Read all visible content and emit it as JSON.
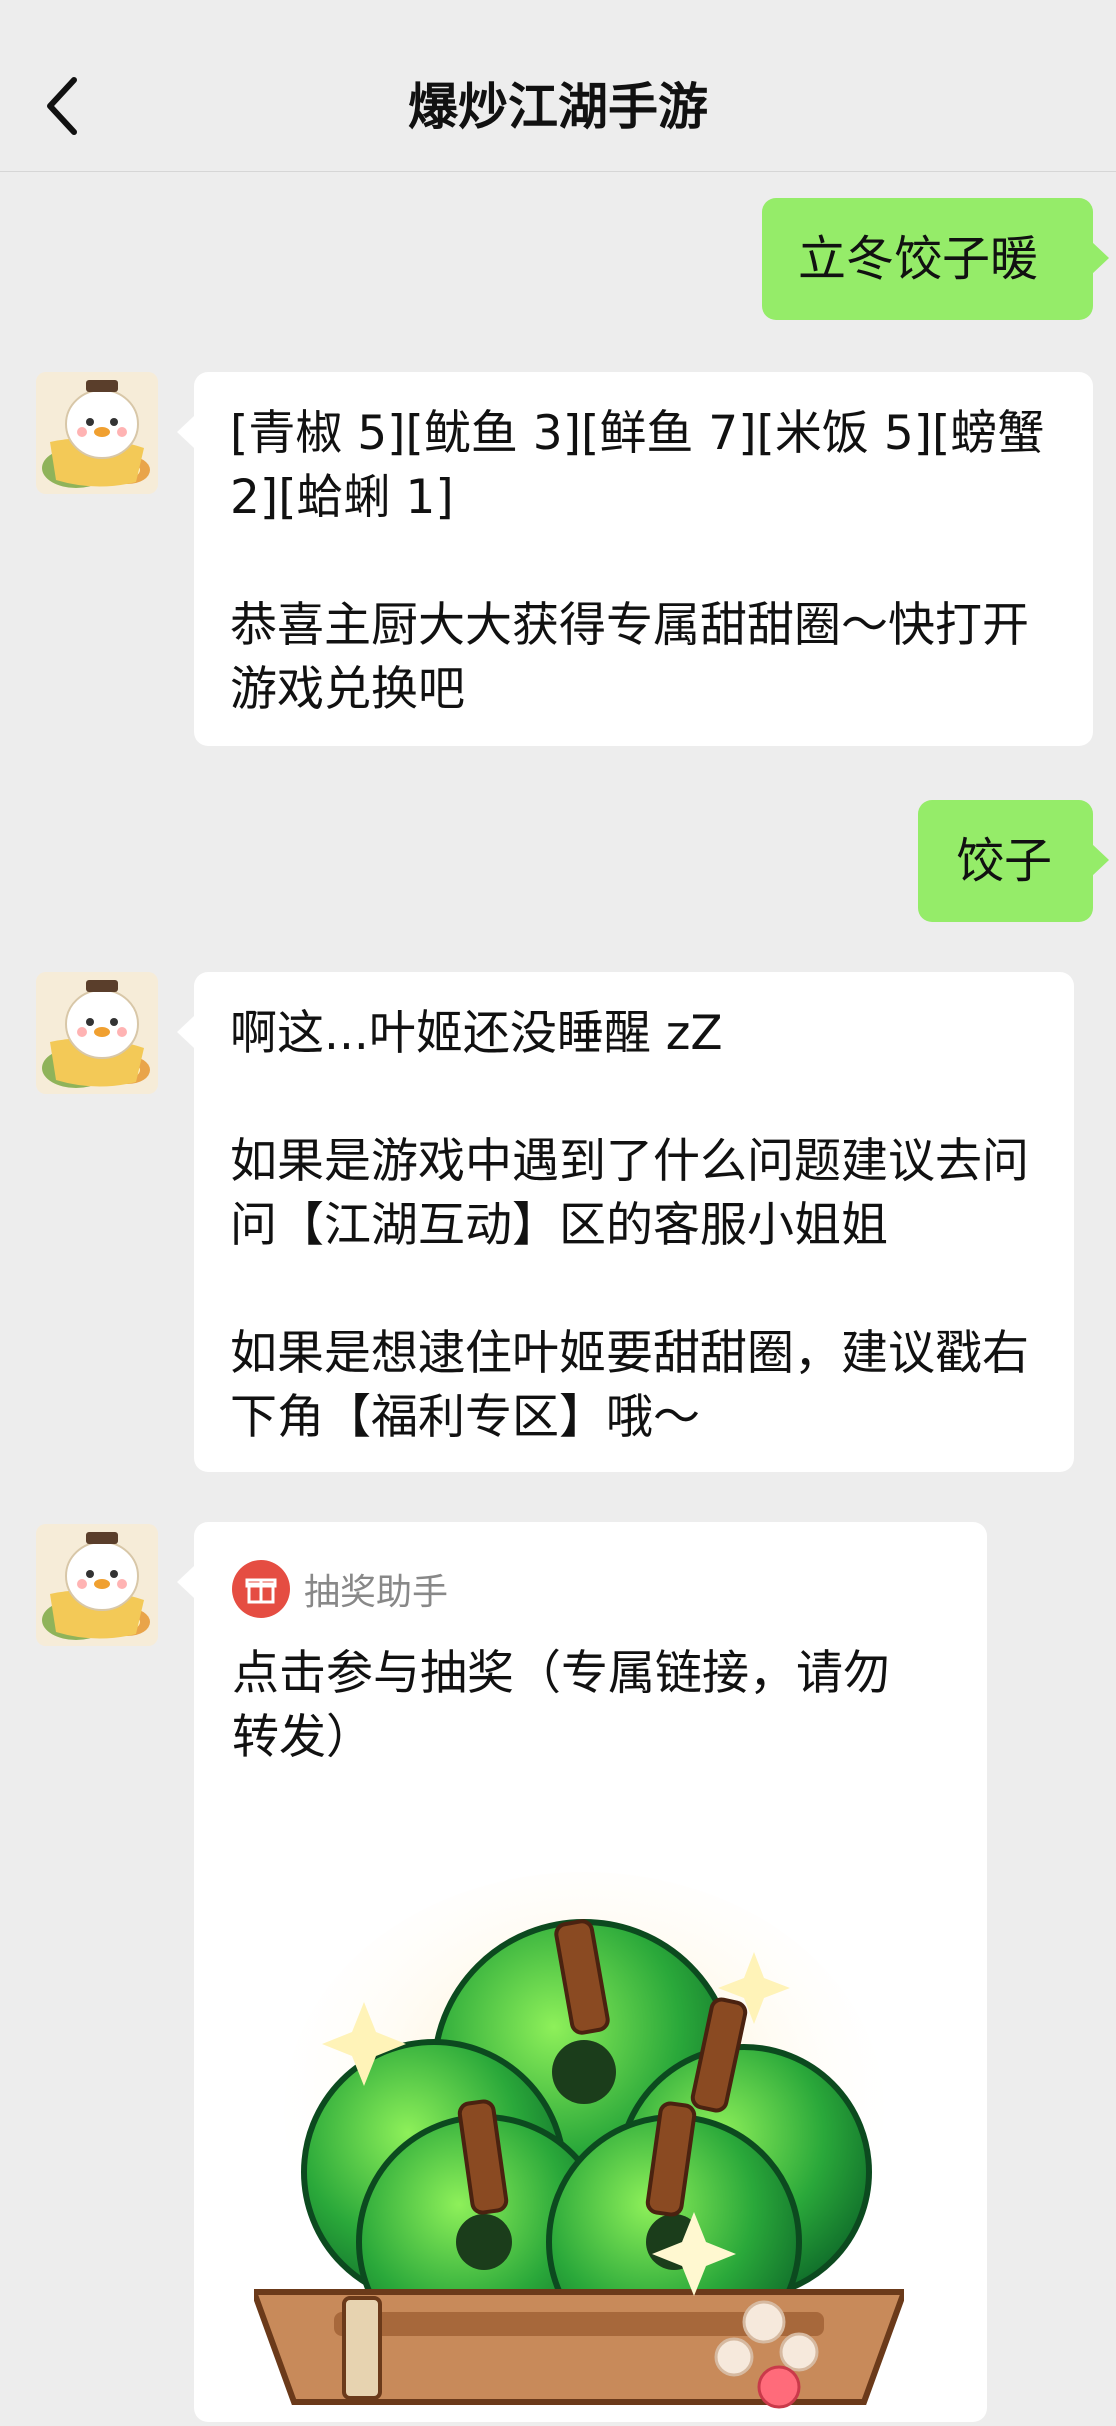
{
  "header": {
    "title": "爆炒江湖手游"
  },
  "messages": {
    "m1": {
      "text": "立冬饺子暖"
    },
    "m2": {
      "line1": "[青椒 5][鱿鱼 3][鲜鱼 7][米饭 5][螃蟹 2][蛤蜊 1]",
      "line2": "恭喜主厨大大获得专属甜甜圈～快打开游戏兑换吧"
    },
    "m3": {
      "text": "饺子"
    },
    "m4": {
      "line1": "啊这...叶姬还没睡醒 zZ",
      "line2": "如果是游戏中遇到了什么问题建议去问问【江湖互动】区的客服小姐姐",
      "line3": "如果是想逮住叶姬要甜甜圈，建议戳右下角【福利专区】哦～"
    },
    "m5": {
      "source": "抽奖助手",
      "title": "点击参与抽奖（专属链接，请勿转发）"
    }
  },
  "colors": {
    "outgoing_bubble": "#95ec69",
    "incoming_bubble": "#ffffff",
    "background": "#ededed",
    "gift_icon": "#e54d42"
  }
}
